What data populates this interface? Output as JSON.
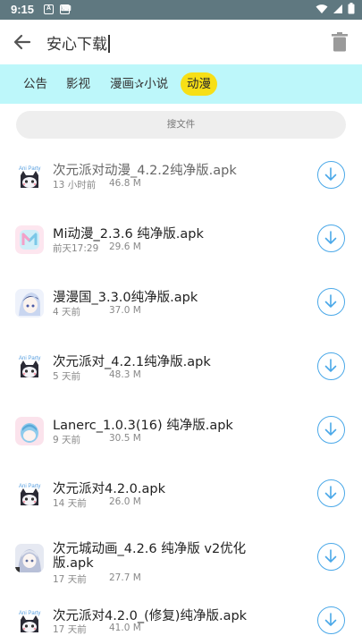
{
  "status_bar": {
    "time": "9:15",
    "notif_a": "A",
    "notif_kb": "⌨"
  },
  "top_bar": {
    "search_value": "安心下载"
  },
  "tabs": [
    {
      "label": "公告"
    },
    {
      "label": "影视"
    },
    {
      "label": "漫画✰小说"
    },
    {
      "label": "动漫",
      "active": true
    }
  ],
  "file_search": {
    "label": "搜文件"
  },
  "files": [
    {
      "name": "次元派对动漫_4.2.2纯净版.apk",
      "time": "13 小时前",
      "size": "46.8 M",
      "icon": "ani-party-cat-icon"
    },
    {
      "name": "Mi动漫_2.3.6 纯净版.apk",
      "time": "前天17:29",
      "size": "29.6 M",
      "icon": "mi-anime-icon"
    },
    {
      "name": "漫漫国_3.3.0纯净版.apk",
      "time": "4 天前",
      "size": "37.0 M",
      "icon": "manmanguo-icon"
    },
    {
      "name": "次元派对_4.2.1纯净版.apk",
      "time": "5 天前",
      "size": "48.3 M",
      "icon": "ani-party-cat-icon"
    },
    {
      "name": "Lanerc_1.0.3(16) 纯净版.apk",
      "time": "9 天前",
      "size": "30.5 M",
      "icon": "lanerc-icon"
    },
    {
      "name": "次元派对4.2.0.apk",
      "time": "14 天前",
      "size": "26.0 M",
      "icon": "ani-party-cat-icon"
    },
    {
      "name": "次元城动画_4.2.6 纯净版 v2优化版.apk",
      "time": "17 天前",
      "size": "27.7 M",
      "icon": "ciyuancheng-icon"
    },
    {
      "name": "次元派对4.2.0_(修复)纯净版.apk",
      "time": "17 天前",
      "size": "41.0 M",
      "icon": "ani-party-cat-icon"
    }
  ],
  "colors": {
    "status_bar": "#5f7880",
    "tab_bar": "#bdf7fa",
    "active_tab": "#f7df16",
    "download_accent": "#4aa8e8"
  }
}
